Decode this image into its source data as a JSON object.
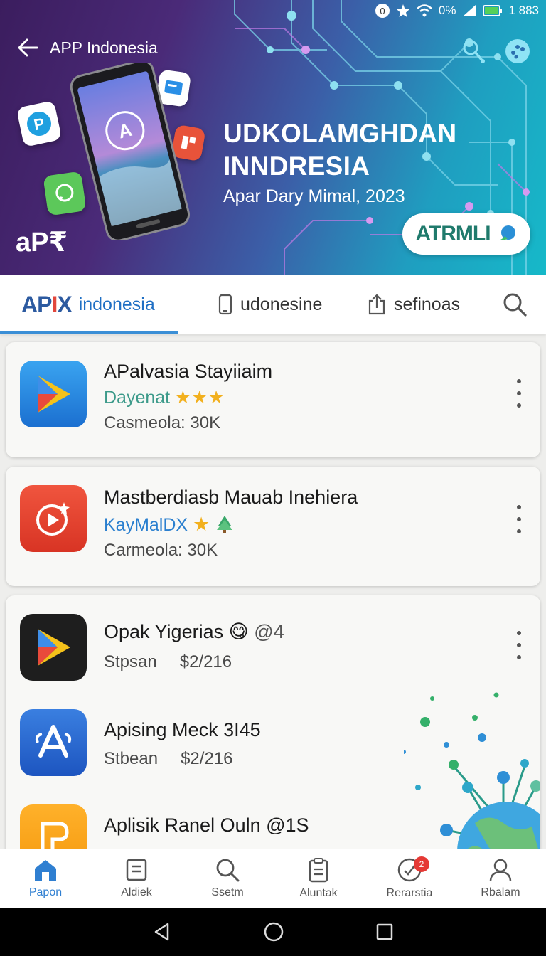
{
  "status_bar": {
    "battery_text": "0%",
    "time": "1 883"
  },
  "header": {
    "title": "APP Indonesia"
  },
  "hero": {
    "headline_line1": "UDKOLAMGHDAN",
    "headline_line2": "INNDRESIA",
    "subtitle": "Apar Dary Mimal, 2023",
    "badge_text": "ATRMLI",
    "logo_text": "aP₹",
    "phone_screen_text": "A"
  },
  "tabs": {
    "brand_mark_main": "AP",
    "brand_mark_accent": "I",
    "brand_mark_tail": "X",
    "brand_label": "indonesia",
    "tab2_label": "udonesine",
    "tab3_label": "sefinoas"
  },
  "apps": [
    {
      "name": "APalvasia Stayiiaim",
      "developer": "Dayenat",
      "rating_stars": "★★★",
      "meta": "Casmeola: 30K"
    },
    {
      "name": "Mastberdiasb Mauab Inehiera",
      "developer": "KayMalDX",
      "rating_stars": "★",
      "meta": "Carmeola: 30K"
    },
    {
      "name": "Opak Yigerias",
      "emoji": "😋",
      "extra": "@4",
      "meta_label": "Stpsan",
      "price": "$2/216"
    },
    {
      "name": "Apising Meck 3I45",
      "meta_label": "Stbean",
      "price": "$2/216"
    },
    {
      "name": "Aplisik Ranel Ouln @1S"
    }
  ],
  "bottom_nav": [
    {
      "label": "Papon"
    },
    {
      "label": "Aldiek"
    },
    {
      "label": "Ssetm"
    },
    {
      "label": "Aluntak"
    },
    {
      "label": "Rerarstia",
      "badge": "2"
    },
    {
      "label": "Rbalam"
    }
  ],
  "colors": {
    "accent": "#2f7fd1",
    "hero_start": "#3b1d5e",
    "hero_end": "#16b9c9",
    "star": "#f2b01e"
  }
}
